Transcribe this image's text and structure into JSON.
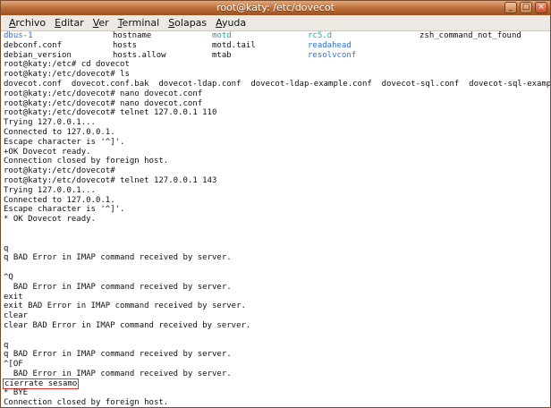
{
  "window": {
    "title": "root@katy: /etc/dovecot",
    "buttons": {
      "minimize": "_",
      "maximize": "□",
      "close": "×"
    }
  },
  "menubar": [
    {
      "label": "Archivo",
      "mnemonic": "A",
      "rest": "rchivo"
    },
    {
      "label": "Editar",
      "mnemonic": "E",
      "rest": "ditar"
    },
    {
      "label": "Ver",
      "mnemonic": "V",
      "rest": "er"
    },
    {
      "label": "Terminal",
      "mnemonic": "T",
      "rest": "erminal"
    },
    {
      "label": "Solapas",
      "mnemonic": "S",
      "rest": "olapas"
    },
    {
      "label": "Ayuda",
      "mnemonic": "A",
      "rest": "yuda"
    }
  ],
  "listing_rows": [
    [
      {
        "text": "dbus-1",
        "kind": "dir"
      },
      {
        "text": "hostname",
        "kind": "file"
      },
      {
        "text": "motd",
        "kind": "link"
      },
      {
        "text": "rc5.d",
        "kind": "link"
      },
      {
        "text": "zsh_command_not_found",
        "kind": "file"
      }
    ],
    [
      {
        "text": "debconf.conf",
        "kind": "file"
      },
      {
        "text": "hosts",
        "kind": "file"
      },
      {
        "text": "motd.tail",
        "kind": "file"
      },
      {
        "text": "readahead",
        "kind": "dir"
      },
      {
        "text": "",
        "kind": "file"
      }
    ],
    [
      {
        "text": "debian_version",
        "kind": "file"
      },
      {
        "text": "hosts.allow",
        "kind": "file"
      },
      {
        "text": "mtab",
        "kind": "file"
      },
      {
        "text": "resolvconf",
        "kind": "dir"
      },
      {
        "text": "",
        "kind": "file"
      }
    ]
  ],
  "lines": [
    "root@katy:/etc# cd dovecot",
    "root@katy:/etc/dovecot# ls",
    "dovecot.conf  dovecot.conf.bak  dovecot-ldap.conf  dovecot-ldap-example.conf  dovecot-sql.conf  dovecot-sql-example.conf",
    "root@katy:/etc/dovecot# nano dovecot.conf",
    "root@katy:/etc/dovecot# nano dovecot.conf",
    "root@katy:/etc/dovecot# telnet 127.0.0.1 110",
    "Trying 127.0.0.1...",
    "Connected to 127.0.0.1.",
    "Escape character is '^]'.",
    "+OK Dovecot ready.",
    "Connection closed by foreign host.",
    "root@katy:/etc/dovecot#",
    "root@katy:/etc/dovecot# telnet 127.0.0.1 143",
    "Trying 127.0.0.1...",
    "Connected to 127.0.0.1.",
    "Escape character is '^]'.",
    "* OK Dovecot ready.",
    "",
    "",
    "q",
    "q BAD Error in IMAP command received by server.",
    "",
    "^Q",
    "  BAD Error in IMAP command received by server.",
    "exit",
    "exit BAD Error in IMAP command received by server.",
    "clear",
    "clear BAD Error in IMAP command received by server.",
    "",
    "q",
    "q BAD Error in IMAP command received by server.",
    "^[OF",
    "  BAD Error in IMAP command received by server.",
    "cierrate sesamo",
    "* BYE",
    "Connection closed by foreign host.",
    "root@katy:/etc/dovecot# "
  ],
  "highlighted_line": "cierrate sesamo",
  "colors": {
    "dir": "#2f6fd8",
    "link": "#22a7a7",
    "highlight_box": "#e03030",
    "titlebar": "#b86a36"
  }
}
